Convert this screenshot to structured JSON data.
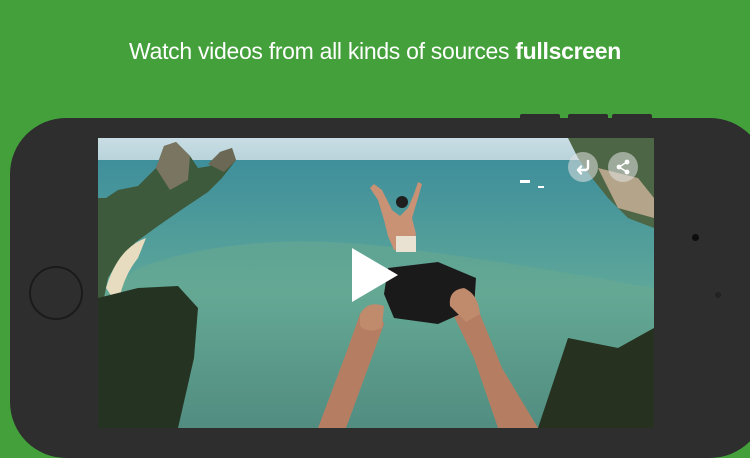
{
  "headline": {
    "text_regular": "Watch videos from all kinds of sources ",
    "text_bold": "fullscreen"
  },
  "player": {
    "back_icon": "return-arrow-icon",
    "share_icon": "share-icon",
    "play_icon": "play-icon"
  },
  "colors": {
    "background": "#43a03b",
    "phone_body": "#2e2e2e",
    "text": "#ffffff"
  }
}
